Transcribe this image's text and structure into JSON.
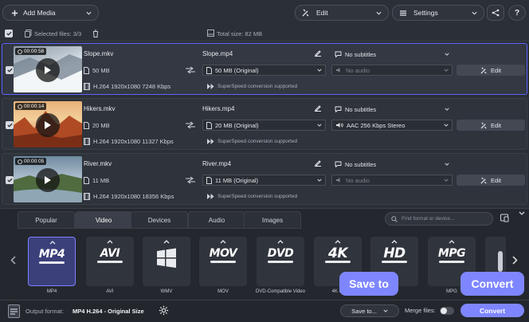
{
  "toolbar": {
    "add_media": "Add Media",
    "edit": "Edit",
    "settings": "Settings"
  },
  "selection": {
    "selected_label": "Selected files: 3/3",
    "total_size": "Total size: 82 MB"
  },
  "files": [
    {
      "duration": "00:00:58",
      "name": "Slope.mkv",
      "size": "50 MB",
      "codec": "H.264 1920x1080 7248 Kbps",
      "output_name": "Slope.mp4",
      "output_size": "50 MB (Original)",
      "superspeed": "SuperSpeed conversion supported",
      "subtitles": "No subtitles",
      "audio": "No audio",
      "edit_label": "Edit"
    },
    {
      "duration": "00:00:14",
      "name": "Hikers.mkv",
      "size": "20 MB",
      "codec": "H.264 1920x1080 11327 Kbps",
      "output_name": "Hikers.mp4",
      "output_size": "20 MB (Original)",
      "superspeed": "SuperSpeed conversion supported",
      "subtitles": "No subtitles",
      "audio": "AAC 256 Kbps Stereo",
      "edit_label": "Edit"
    },
    {
      "duration": "00:00:05",
      "name": "River.mkv",
      "size": "11 MB",
      "codec": "H.264 1920x1080 18356 Kbps",
      "output_name": "River.mp4",
      "output_size": "11 MB (Original)",
      "superspeed": "SuperSpeed conversion supported",
      "subtitles": "No subtitles",
      "audio": "No audio",
      "edit_label": "Edit"
    }
  ],
  "tabs": [
    "Popular",
    "Video",
    "Devices",
    "Audio",
    "Images"
  ],
  "search_placeholder": "Find format or device...",
  "formats": [
    {
      "logo": "MP4",
      "label": "MP4"
    },
    {
      "logo": "AVI",
      "label": "AVI"
    },
    {
      "logo": "",
      "label": "WMV"
    },
    {
      "logo": "MOV",
      "label": "MOV"
    },
    {
      "logo": "DVD",
      "label": "DVD-Compatible Video"
    },
    {
      "logo": "4K",
      "label": "4K Ul"
    },
    {
      "logo": "HD",
      "label": "HD"
    },
    {
      "logo": "MPG",
      "label": "MPG"
    }
  ],
  "bottom": {
    "output_label": "Output format:",
    "output_value": "MP4 H.264 - Original Size",
    "save_to": "Save to...",
    "merge": "Merge files:",
    "convert": "Convert"
  },
  "tooltips": {
    "save_to": "Save to",
    "convert": "Convert"
  },
  "colors": {
    "accent": "#7e86ff",
    "background": "#2b2f36"
  }
}
